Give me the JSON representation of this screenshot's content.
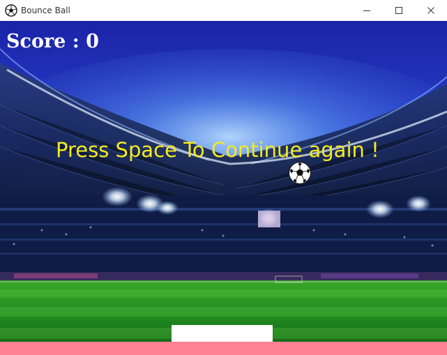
{
  "window": {
    "title": "Bounce Ball",
    "app_icon": "soccer-ball-icon",
    "controls": [
      "minimize-icon",
      "maximize-icon",
      "close-icon"
    ]
  },
  "game": {
    "score_text": "Score : 0",
    "score_value": 0,
    "message": "Press Space To Continue again !",
    "ball_icon": "soccer-ball-icon",
    "background": "stadium-night-scene"
  },
  "colors": {
    "message": "#f5ea1d",
    "score": "#ffffff",
    "paddle": "#ffffff",
    "ground_bar": "#ff7f93",
    "sky": "#1a2fb8"
  }
}
